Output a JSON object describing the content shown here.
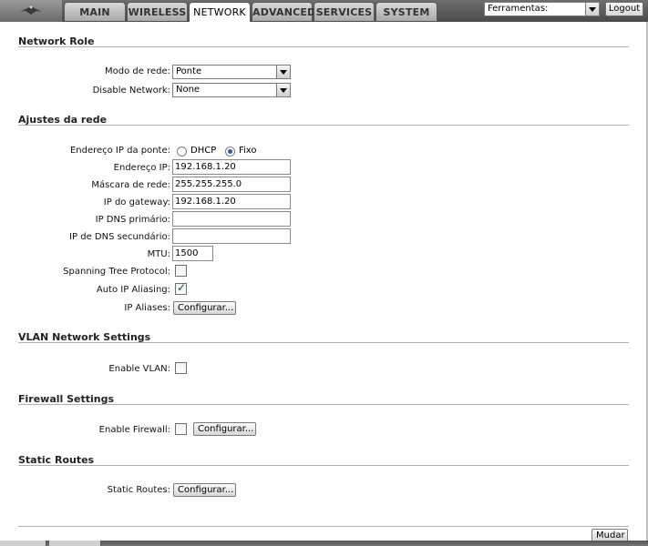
{
  "tabs": [
    {
      "label": "MAIN"
    },
    {
      "label": "WIRELESS"
    },
    {
      "label": "NETWORK"
    },
    {
      "label": "ADVANCED"
    },
    {
      "label": "SERVICES"
    },
    {
      "label": "SYSTEM"
    }
  ],
  "tools": {
    "selected": "Ferramentas:"
  },
  "logout_label": "Logout",
  "sections": {
    "network_role": "Network Role",
    "ajustes": "Ajustes da rede",
    "vlan": "VLAN Network Settings",
    "firewall": "Firewall Settings",
    "routes": "Static Routes"
  },
  "network_role": {
    "mode_label": "Modo de rede:",
    "mode_value": "Ponte",
    "disable_label": "Disable Network:",
    "disable_value": "None"
  },
  "ajustes": {
    "ip_mode_label": "Endereço IP da ponte:",
    "dhcp_label": "DHCP",
    "fixo_label": "Fixo",
    "ip_label": "Endereço IP:",
    "ip_value": "192.168.1.20",
    "mask_label": "Máscara de rede:",
    "mask_value": "255.255.255.0",
    "gw_label": "IP do gateway:",
    "gw_value": "192.168.1.20",
    "dns1_label": "IP DNS primário:",
    "dns1_value": "",
    "dns2_label": "IP de DNS secundário:",
    "dns2_value": "",
    "mtu_label": "MTU:",
    "mtu_value": "1500",
    "stp_label": "Spanning Tree Protocol:",
    "stp_checked": false,
    "alias_label": "Auto IP Aliasing:",
    "alias_checked": true,
    "aliases_label": "IP Aliases:",
    "configure_label": "Configurar..."
  },
  "vlan": {
    "label": "Enable VLAN:",
    "checked": false
  },
  "firewall": {
    "label": "Enable Firewall:",
    "checked": false,
    "configure_label": "Configurar..."
  },
  "routes": {
    "label": "Static Routes:",
    "configure_label": "Configurar..."
  },
  "apply_label": "Mudar"
}
